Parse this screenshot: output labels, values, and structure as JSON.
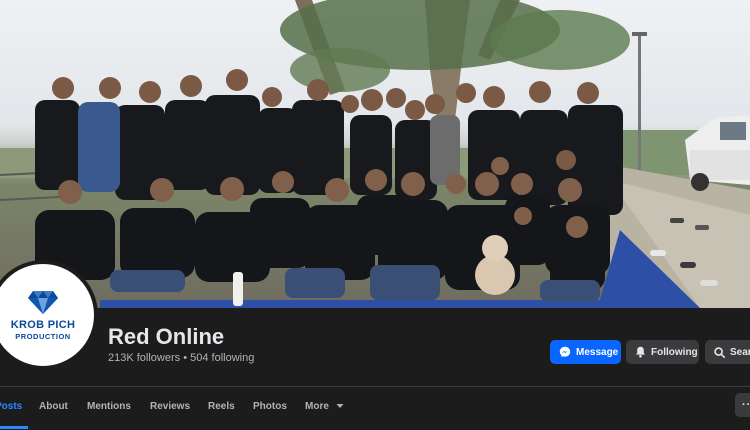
{
  "page": {
    "name": "Red Online",
    "followers": "213K followers",
    "separator": " • ",
    "following": "504 following"
  },
  "logo": {
    "line1": "KROB PICH",
    "line2": "PRODUCTION",
    "color": "#0b4a98"
  },
  "buttons": {
    "message": "Message",
    "following": "Following",
    "search": "Search"
  },
  "tabs": [
    {
      "label": "Posts",
      "active": true
    },
    {
      "label": "About"
    },
    {
      "label": "Mentions"
    },
    {
      "label": "Reviews"
    },
    {
      "label": "Reels"
    },
    {
      "label": "Photos"
    },
    {
      "label": "More"
    }
  ],
  "colors": {
    "background": "#1c1c1d",
    "accent": "#0866ff",
    "active_tab": "#2d88ff",
    "secondary_button": "#3a3b3c"
  },
  "icons": [
    "messenger-icon",
    "bell-icon",
    "search-icon",
    "caret-down-icon",
    "more-options-icon"
  ]
}
